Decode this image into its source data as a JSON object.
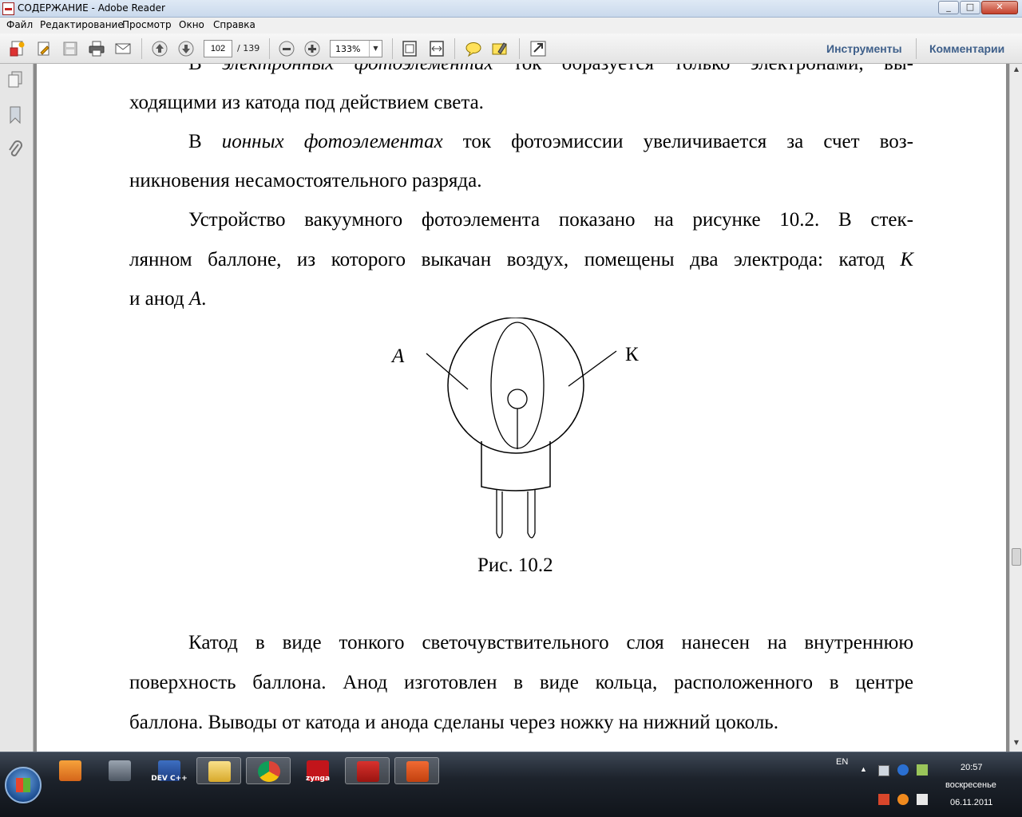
{
  "window": {
    "title": "СОДЕРЖАНИЕ - Adobe Reader",
    "min": "_",
    "max": "□",
    "close": "✕"
  },
  "menu": [
    "Файл",
    "Редактирование",
    "Просмотр",
    "Окно",
    "Справка"
  ],
  "toolbar": {
    "page_current": "102",
    "page_total": "/ 139",
    "zoom": "133%",
    "tools_label": "Инструменты",
    "comments_label": "Комментарии"
  },
  "document": {
    "lines": [
      {
        "pre": "В ",
        "it": "электронных фотоэлементах",
        "post": " ток образуется только электронами, вы-"
      },
      {
        "pre": "ходящими из катода под действием света.",
        "it": "",
        "post": ""
      },
      {
        "pre": "В ",
        "it": "ионных фотоэлементах",
        "post": " ток фотоэмиссии увеличивается за счет воз-"
      },
      {
        "pre": "никновения несамостоятельного разряда.",
        "it": "",
        "post": ""
      },
      {
        "pre": "Устройство вакуумного фотоэлемента показано на рисунке 10.2. В стек-",
        "it": "",
        "post": ""
      },
      {
        "pre": "лянном баллоне, из которого выкачан воздух, помещены два электрода: катод ",
        "it": "К",
        "post": ""
      },
      {
        "pre": "и анод ",
        "it": "А",
        "post": "."
      },
      {
        "pre": "Катод в виде тонкого светочувствительного слоя нанесен на внутреннюю",
        "it": "",
        "post": ""
      },
      {
        "pre": "поверхность баллона. Анод изготовлен в виде кольца, расположенного в центре",
        "it": "",
        "post": ""
      },
      {
        "pre": "баллона. Выводы от катода и анода сделаны через ножку на нижний цоколь.",
        "it": "",
        "post": ""
      }
    ],
    "figure": {
      "label_anode": "А",
      "label_cathode": "К",
      "caption": "Рис. 10.2"
    }
  },
  "taskbar": {
    "apps": [
      {
        "name": "media-player",
        "label": ""
      },
      {
        "name": "archive",
        "label": ""
      },
      {
        "name": "dev-cpp",
        "label": "DEV C++"
      },
      {
        "name": "explorer",
        "label": ""
      },
      {
        "name": "chrome",
        "label": ""
      },
      {
        "name": "zynga",
        "label": "zynga"
      },
      {
        "name": "adobe-reader",
        "label": ""
      },
      {
        "name": "powerpoint",
        "label": ""
      }
    ],
    "lang": "EN",
    "time": "20:57",
    "day": "воскресенье",
    "date": "06.11.2011"
  },
  "colors": {
    "tools_text": "#3e5f8a",
    "reader_red": "#c8201e",
    "page_bg": "#ffffff"
  }
}
